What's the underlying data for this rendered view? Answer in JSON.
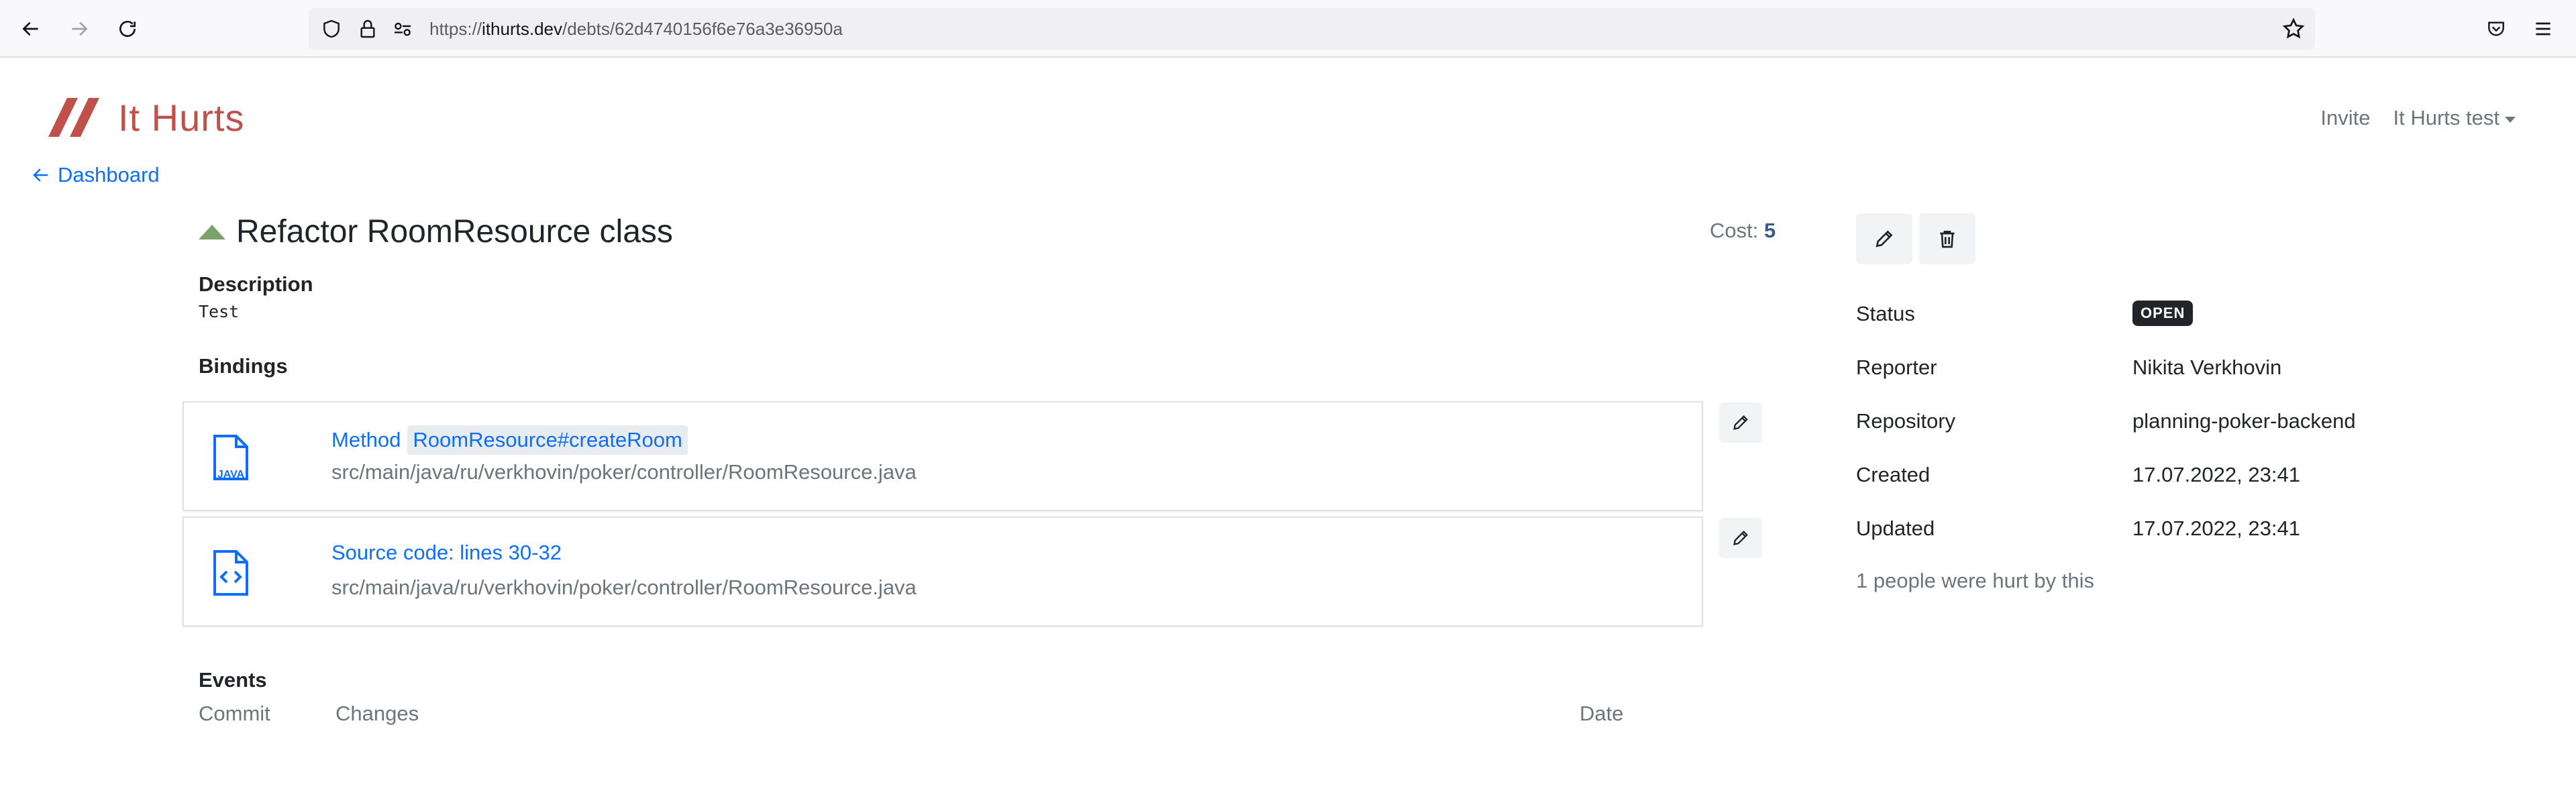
{
  "browser": {
    "url_host": "ithurts.dev",
    "url_prefix": "https://",
    "url_path": "/debts/62d4740156f6e76a3e36950a"
  },
  "header": {
    "brand_name": "It Hurts",
    "invite_label": "Invite",
    "user_label": "It Hurts test"
  },
  "nav": {
    "back_label": "Dashboard"
  },
  "debt": {
    "title": "Refactor RoomResource class",
    "cost_label": "Cost:",
    "cost_value": "5",
    "description_label": "Description",
    "description_text": "Test",
    "bindings_label": "Bindings",
    "bindings": [
      {
        "icon": "java-file-icon",
        "icon_text": "JAVA",
        "kind": "Method",
        "target": "RoomResource#createRoom",
        "path": "src/main/java/ru/verkhovin/poker/controller/RoomResource.java"
      },
      {
        "icon": "code-file-icon",
        "title": "Source code: lines 30-32",
        "path": "src/main/java/ru/verkhovin/poker/controller/RoomResource.java"
      }
    ],
    "events_label": "Events",
    "events_columns": [
      "Commit",
      "Changes",
      "Date"
    ]
  },
  "sidebar": {
    "status_label": "Status",
    "status_value": "OPEN",
    "reporter_label": "Reporter",
    "reporter_value": "Nikita Verkhovin",
    "repository_label": "Repository",
    "repository_value": "planning-poker-backend",
    "created_label": "Created",
    "created_value": "17.07.2022, 23:41",
    "updated_label": "Updated",
    "updated_value": "17.07.2022, 23:41",
    "hurt_text": "1 people were hurt by this"
  },
  "colors": {
    "brand": "#c0504a",
    "link": "#0d6efd",
    "muted": "#6c757d",
    "priority_arrow": "#7aa36a",
    "badge_bg": "#212529"
  }
}
